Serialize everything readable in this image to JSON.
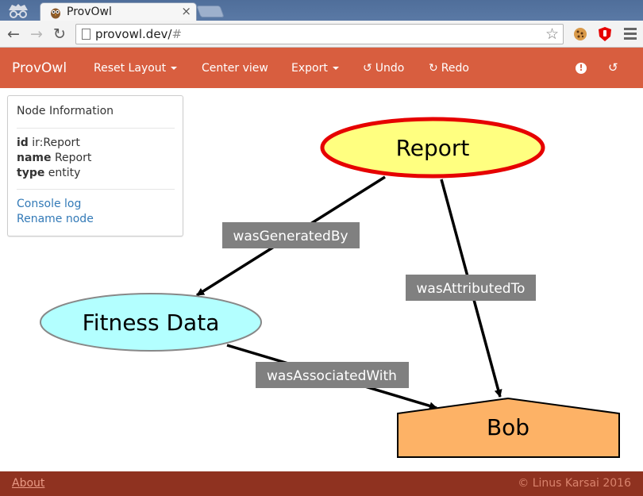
{
  "browser": {
    "tab_title": "ProvOwl",
    "tab_close": "×",
    "url_host": "provowl.dev/",
    "url_hash": "#",
    "back": "←",
    "forward": "→",
    "reload": "↻",
    "star": "☆"
  },
  "navbar": {
    "brand": "ProvOwl",
    "reset_layout": "Reset Layout",
    "center_view": "Center view",
    "export": "Export",
    "undo": "Undo",
    "redo": "Redo",
    "undo_icon": "↺",
    "redo_icon": "↻",
    "alert_icon": "!",
    "history_icon": "↺"
  },
  "node_info": {
    "heading": "Node Information",
    "props": [
      {
        "key": "id",
        "value": "ir:Report"
      },
      {
        "key": "name",
        "value": "Report"
      },
      {
        "key": "type",
        "value": "entity"
      }
    ],
    "links": [
      "Console log",
      "Rename node"
    ]
  },
  "graph": {
    "nodes": {
      "report": {
        "label": "Report",
        "kind": "entity",
        "fill": "#ffff80",
        "stroke": "#e60000",
        "selected": true
      },
      "fitness": {
        "label": "Fitness Data",
        "kind": "activity",
        "fill": "#b3ffff",
        "stroke": "#888888"
      },
      "bob": {
        "label": "Bob",
        "kind": "agent",
        "fill": "#fdb266",
        "stroke": "#000000"
      }
    },
    "edges": {
      "was_generated_by": "wasGeneratedBy",
      "was_attributed_to": "wasAttributedTo",
      "was_associated_with": "wasAssociatedWith"
    }
  },
  "footer": {
    "about": "About",
    "copyright": "© Linus Karsai 2016"
  },
  "colors": {
    "navbar": "#d85e3f",
    "footer": "#8f3220",
    "link": "#337ab7",
    "edge_label_bg": "#808080"
  }
}
